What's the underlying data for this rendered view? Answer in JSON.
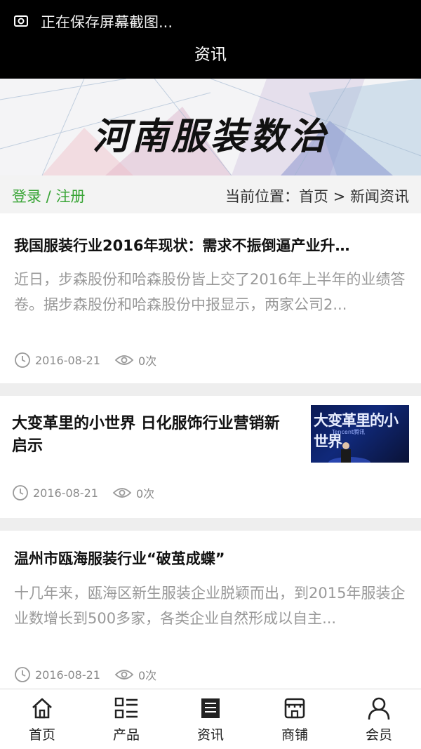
{
  "status_bar": {
    "text": "正在保存屏幕截图..."
  },
  "header": {
    "title": "资讯"
  },
  "banner": {
    "title": "河南服装数治"
  },
  "login_bar": {
    "login": "登录",
    "separator": " / ",
    "register": "注册",
    "breadcrumb": "当前位置：首页 > 新闻资讯"
  },
  "articles": [
    {
      "title": "我国服装行业2016年现状：需求不振倒逼产业升…",
      "summary": "近日，步森股份和哈森股份皆上交了2016年上半年的业绩答卷。据步森股份和哈森股份中报显示，两家公司2...",
      "date": "2016-08-21",
      "views": "0次"
    },
    {
      "title": "大变革里的小世界 日化服饰行业营销新启示",
      "thumb_text": "大变革里的小世界",
      "thumb_sub": "Tencent腾讯",
      "date": "2016-08-21",
      "views": "0次"
    },
    {
      "title": "温州市瓯海服装行业“破茧成蝶”",
      "summary": "十几年来，瓯海区新生服装企业脱颖而出，到2015年服装企业数增长到500多家，各类企业自然形成以自主...",
      "date": "2016-08-21",
      "views": "0次"
    }
  ],
  "tabbar": {
    "items": [
      {
        "label": "首页",
        "icon": "home-icon"
      },
      {
        "label": "产品",
        "icon": "grid-list-icon"
      },
      {
        "label": "资讯",
        "icon": "news-icon"
      },
      {
        "label": "商铺",
        "icon": "shop-icon"
      },
      {
        "label": "会员",
        "icon": "user-icon"
      }
    ]
  }
}
